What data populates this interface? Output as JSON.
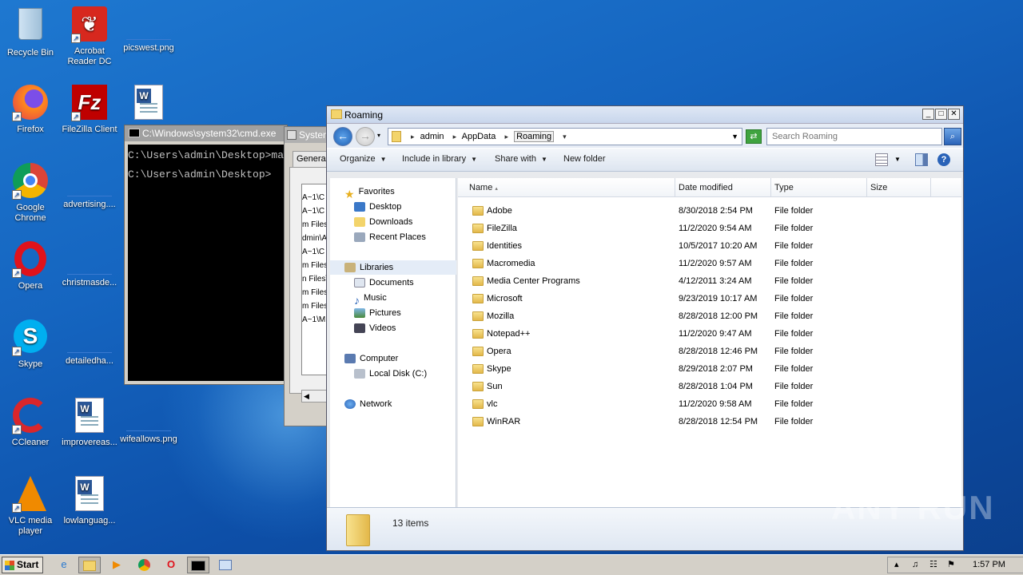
{
  "desktop": {
    "icons": [
      {
        "label": "Recycle Bin"
      },
      {
        "label": "Acrobat Reader DC"
      },
      {
        "label": "picswest.png"
      },
      {
        "label": "Firefox"
      },
      {
        "label": "FileZilla Client"
      },
      {
        "label": "Google Chrome"
      },
      {
        "label": "advertising...."
      },
      {
        "label": "Opera"
      },
      {
        "label": "christmasde..."
      },
      {
        "label": "Skype"
      },
      {
        "label": "detailedha..."
      },
      {
        "label": "CCleaner"
      },
      {
        "label": "improvereas..."
      },
      {
        "label": "wifeallows.png"
      },
      {
        "label": "VLC media player"
      },
      {
        "label": "lowlanguag..."
      }
    ]
  },
  "cmd": {
    "title": "C:\\Windows\\system32\\cmd.exe",
    "lines": [
      "C:\\Users\\admin\\Desktop>ma",
      "C:\\Users\\admin\\Desktop>"
    ]
  },
  "sysprop": {
    "title": "System",
    "tab": "General",
    "list": [
      "A~1\\C",
      "A~1\\C",
      "m Files",
      "dmin\\A",
      "A~1\\C",
      "m Files",
      "n Files\\",
      "m Files",
      "m Files",
      "A~1\\M"
    ]
  },
  "explorer": {
    "title": "Roaming",
    "breadcrumb": [
      "admin",
      "AppData",
      "Roaming"
    ],
    "search_placeholder": "Search Roaming",
    "toolbar": {
      "organize": "Organize",
      "include": "Include in library",
      "share": "Share with",
      "new_folder": "New folder"
    },
    "nav": {
      "favorites": "Favorites",
      "desktop": "Desktop",
      "downloads": "Downloads",
      "recent": "Recent Places",
      "libraries": "Libraries",
      "documents": "Documents",
      "music": "Music",
      "pictures": "Pictures",
      "videos": "Videos",
      "computer": "Computer",
      "local_disk": "Local Disk (C:)",
      "network": "Network"
    },
    "columns": {
      "name": "Name",
      "date": "Date modified",
      "type": "Type",
      "size": "Size"
    },
    "rows": [
      {
        "name": "Adobe",
        "date": "8/30/2018 2:54 PM",
        "type": "File folder"
      },
      {
        "name": "FileZilla",
        "date": "11/2/2020 9:54 AM",
        "type": "File folder"
      },
      {
        "name": "Identities",
        "date": "10/5/2017 10:20 AM",
        "type": "File folder"
      },
      {
        "name": "Macromedia",
        "date": "11/2/2020 9:57 AM",
        "type": "File folder"
      },
      {
        "name": "Media Center Programs",
        "date": "4/12/2011 3:24 AM",
        "type": "File folder"
      },
      {
        "name": "Microsoft",
        "date": "9/23/2019 10:17 AM",
        "type": "File folder"
      },
      {
        "name": "Mozilla",
        "date": "8/28/2018 12:00 PM",
        "type": "File folder"
      },
      {
        "name": "Notepad++",
        "date": "11/2/2020 9:47 AM",
        "type": "File folder"
      },
      {
        "name": "Opera",
        "date": "8/28/2018 12:46 PM",
        "type": "File folder"
      },
      {
        "name": "Skype",
        "date": "8/29/2018 2:07 PM",
        "type": "File folder"
      },
      {
        "name": "Sun",
        "date": "8/28/2018 1:04 PM",
        "type": "File folder"
      },
      {
        "name": "vlc",
        "date": "11/2/2020 9:58 AM",
        "type": "File folder"
      },
      {
        "name": "WinRAR",
        "date": "8/28/2018 12:54 PM",
        "type": "File folder"
      }
    ],
    "item_count": "13 items"
  },
  "taskbar": {
    "start": "Start",
    "clock": "1:57 PM"
  },
  "watermark": "ANY RUN"
}
